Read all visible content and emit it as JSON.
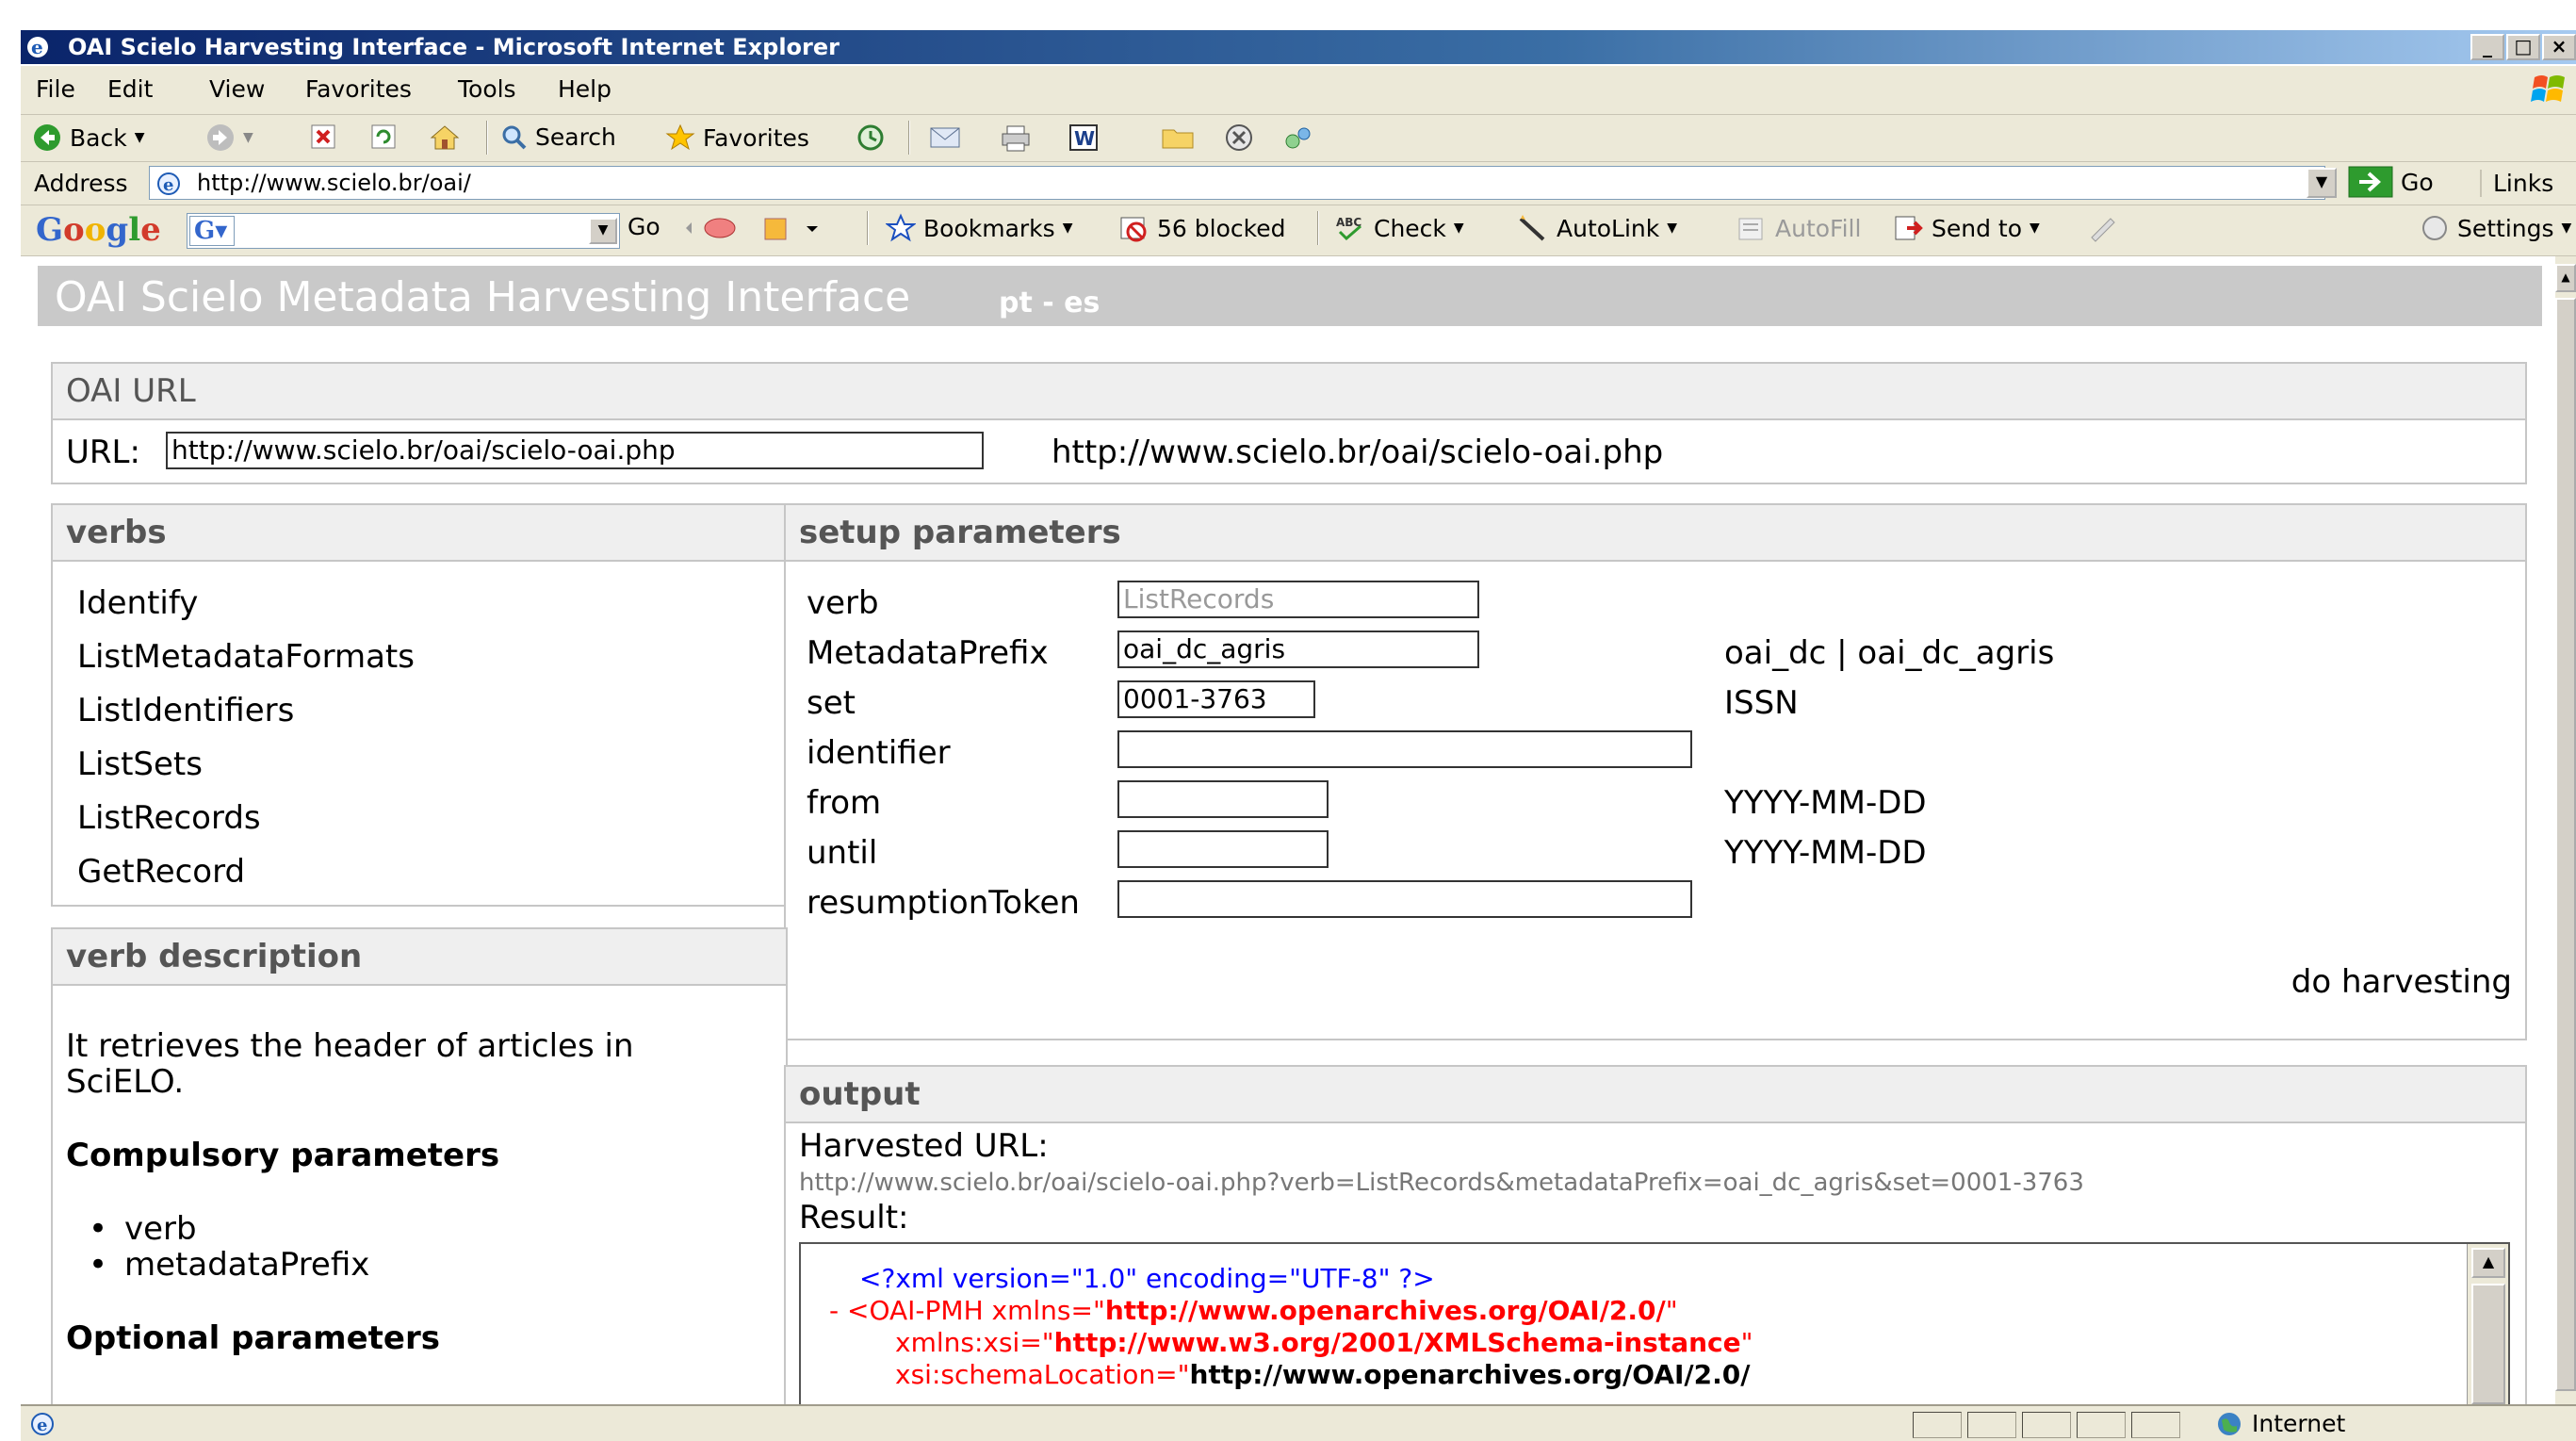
{
  "window": {
    "title": "OAI Scielo Harvesting Interface - Microsoft Internet Explorer",
    "min": "_",
    "max": "□",
    "close": "×"
  },
  "menu": {
    "file": "File",
    "edit": "Edit",
    "view": "View",
    "favorites": "Favorites",
    "tools": "Tools",
    "help": "Help"
  },
  "toolbar": {
    "back": "Back",
    "search": "Search",
    "favorites": "Favorites"
  },
  "address": {
    "label": "Address",
    "url": "http://www.scielo.br/oai/",
    "go": "Go",
    "links": "Links"
  },
  "googlebar": {
    "logo": "Google",
    "go": "Go",
    "bookmarks": "Bookmarks",
    "blocked": "56 blocked",
    "check": "Check",
    "autolink": "AutoLink",
    "autofill": "AutoFill",
    "sendto": "Send to",
    "settings": "Settings"
  },
  "page": {
    "header_title": "OAI Scielo Metadata Harvesting Interface",
    "header_langs": "pt - es",
    "oai_url": {
      "heading": "OAI URL",
      "label": "URL:",
      "value": "http://www.scielo.br/oai/scielo-oai.php",
      "display": "http://www.scielo.br/oai/scielo-oai.php"
    },
    "verbs": {
      "heading": "verbs",
      "items": [
        "Identify",
        "ListMetadataFormats",
        "ListIdentifiers",
        "ListSets",
        "ListRecords",
        "GetRecord"
      ]
    },
    "setup": {
      "heading": "setup parameters",
      "verb_label": "verb",
      "verb_value": "ListRecords",
      "prefix_label": "MetadataPrefix",
      "prefix_value": "oai_dc_agris",
      "prefix_hint": "oai_dc | oai_dc_agris",
      "set_label": "set",
      "set_value": "0001-3763",
      "set_hint": "ISSN",
      "identifier_label": "identifier",
      "identifier_value": "",
      "from_label": "from",
      "from_value": "",
      "from_hint": "YYYY-MM-DD",
      "until_label": "until",
      "until_value": "",
      "until_hint": "YYYY-MM-DD",
      "token_label": "resumptionToken",
      "token_value": "",
      "harvest_link": "do harvesting"
    },
    "verb_description": {
      "heading": "verb description",
      "text_line1": "It retrieves the header of articles in",
      "text_line2": "SciELO.",
      "compulsory_heading": "Compulsory parameters",
      "compulsory": [
        "verb",
        "metadataPrefix"
      ],
      "optional_heading": "Optional parameters"
    },
    "output": {
      "heading": "output",
      "harvested_label": "Harvested URL:",
      "harvested_url": "http://www.scielo.br/oai/scielo-oai.php?verb=ListRecords&metadataPrefix=oai_dc_agris&set=0001-3763",
      "result_label": "Result:",
      "xml": {
        "decl": "<?xml version=\"1.0\" encoding=\"UTF-8\" ?>",
        "l2_prefix": "- <OAI-PMH xmlns=\"",
        "l2_value": "http://www.openarchives.org/OAI/2.0/",
        "l2_suffix": "\"",
        "l3_prefix": "xmlns:xsi=\"",
        "l3_value": "http://www.w3.org/2001/XMLSchema-instance",
        "l3_suffix": "\"",
        "l4_prefix": "xsi:schemaLocation=\"",
        "l4_value": "http://www.openarchives.org/OAI/2.0/"
      }
    }
  },
  "status": {
    "zone": "Internet"
  },
  "colors": {
    "xml_blue": "#0000ff",
    "xml_red": "#ff0000",
    "header_bg": "#c9c9c9"
  }
}
